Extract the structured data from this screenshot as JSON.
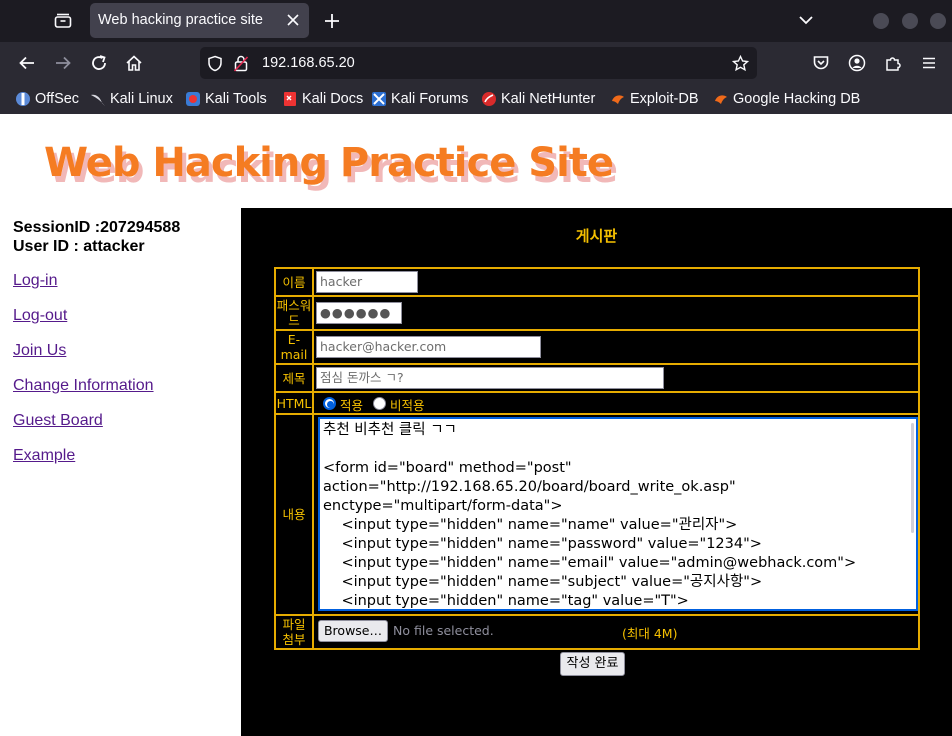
{
  "browser": {
    "tab_title": "Web hacking practice site",
    "url": "192.168.65.20",
    "bookmarks": [
      {
        "label": "OffSec",
        "icon": "offsec-icon"
      },
      {
        "label": "Kali Linux",
        "icon": "kali-linux-icon"
      },
      {
        "label": "Kali Tools",
        "icon": "kali-tools-icon"
      },
      {
        "label": "Kali Docs",
        "icon": "kali-docs-icon"
      },
      {
        "label": "Kali Forums",
        "icon": "kali-forums-icon"
      },
      {
        "label": "Kali NetHunter",
        "icon": "kali-nethunter-icon"
      },
      {
        "label": "Exploit-DB",
        "icon": "exploit-db-icon"
      },
      {
        "label": "Google Hacking DB",
        "icon": "google-hacking-db-icon"
      }
    ]
  },
  "site": {
    "logo_text": "Web Hacking Practice Site"
  },
  "sidebar": {
    "session_id": "SessionID :207294588",
    "user_id": "User ID : attacker",
    "links": [
      "Log-in",
      "Log-out",
      "Join Us",
      "Change Information",
      "Guest Board",
      "Example"
    ]
  },
  "board": {
    "title": "게시판",
    "fields": {
      "name_label": "이름",
      "name_value": "hacker",
      "password_label": "패스워드",
      "password_value": "●●●●●●",
      "email_label": "E-mail",
      "email_value": "hacker@hacker.com",
      "subject_label": "제목",
      "subject_value": "점심 돈까스 ㄱ?",
      "html_label": "HTML",
      "html_on_label": "적용",
      "html_off_label": "비적용",
      "content_label": "내용",
      "content_value": "추천 비추천 클릭 ㄱㄱ\n\n<form id=\"board\" method=\"post\" action=\"http://192.168.65.20/board/board_write_ok.asp\" enctype=\"multipart/form-data\">\n    <input type=\"hidden\" name=\"name\" value=\"관리자\">\n    <input type=\"hidden\" name=\"password\" value=\"1234\">\n    <input type=\"hidden\" name=\"email\" value=\"admin@webhack.com\">\n    <input type=\"hidden\" name=\"subject\" value=\"공지사항\">\n    <input type=\"hidden\" name=\"tag\" value=\"T\">\n    <input type=\"hidden\" name=\"content\" value=\"서비스의 기술적인 문제로 인해 고",
      "file_label": "파일첨부",
      "browse_label": "Browse…",
      "file_status": "No file selected.",
      "max_size": "(최대 4M)"
    },
    "submit_label": "작성 완료"
  },
  "colors": {
    "board_bg": "#000000",
    "accent_gold": "#f5c000",
    "border_gold": "#e6ac00",
    "logo_orange": "#f57c22",
    "link_purple": "#551a8b"
  }
}
